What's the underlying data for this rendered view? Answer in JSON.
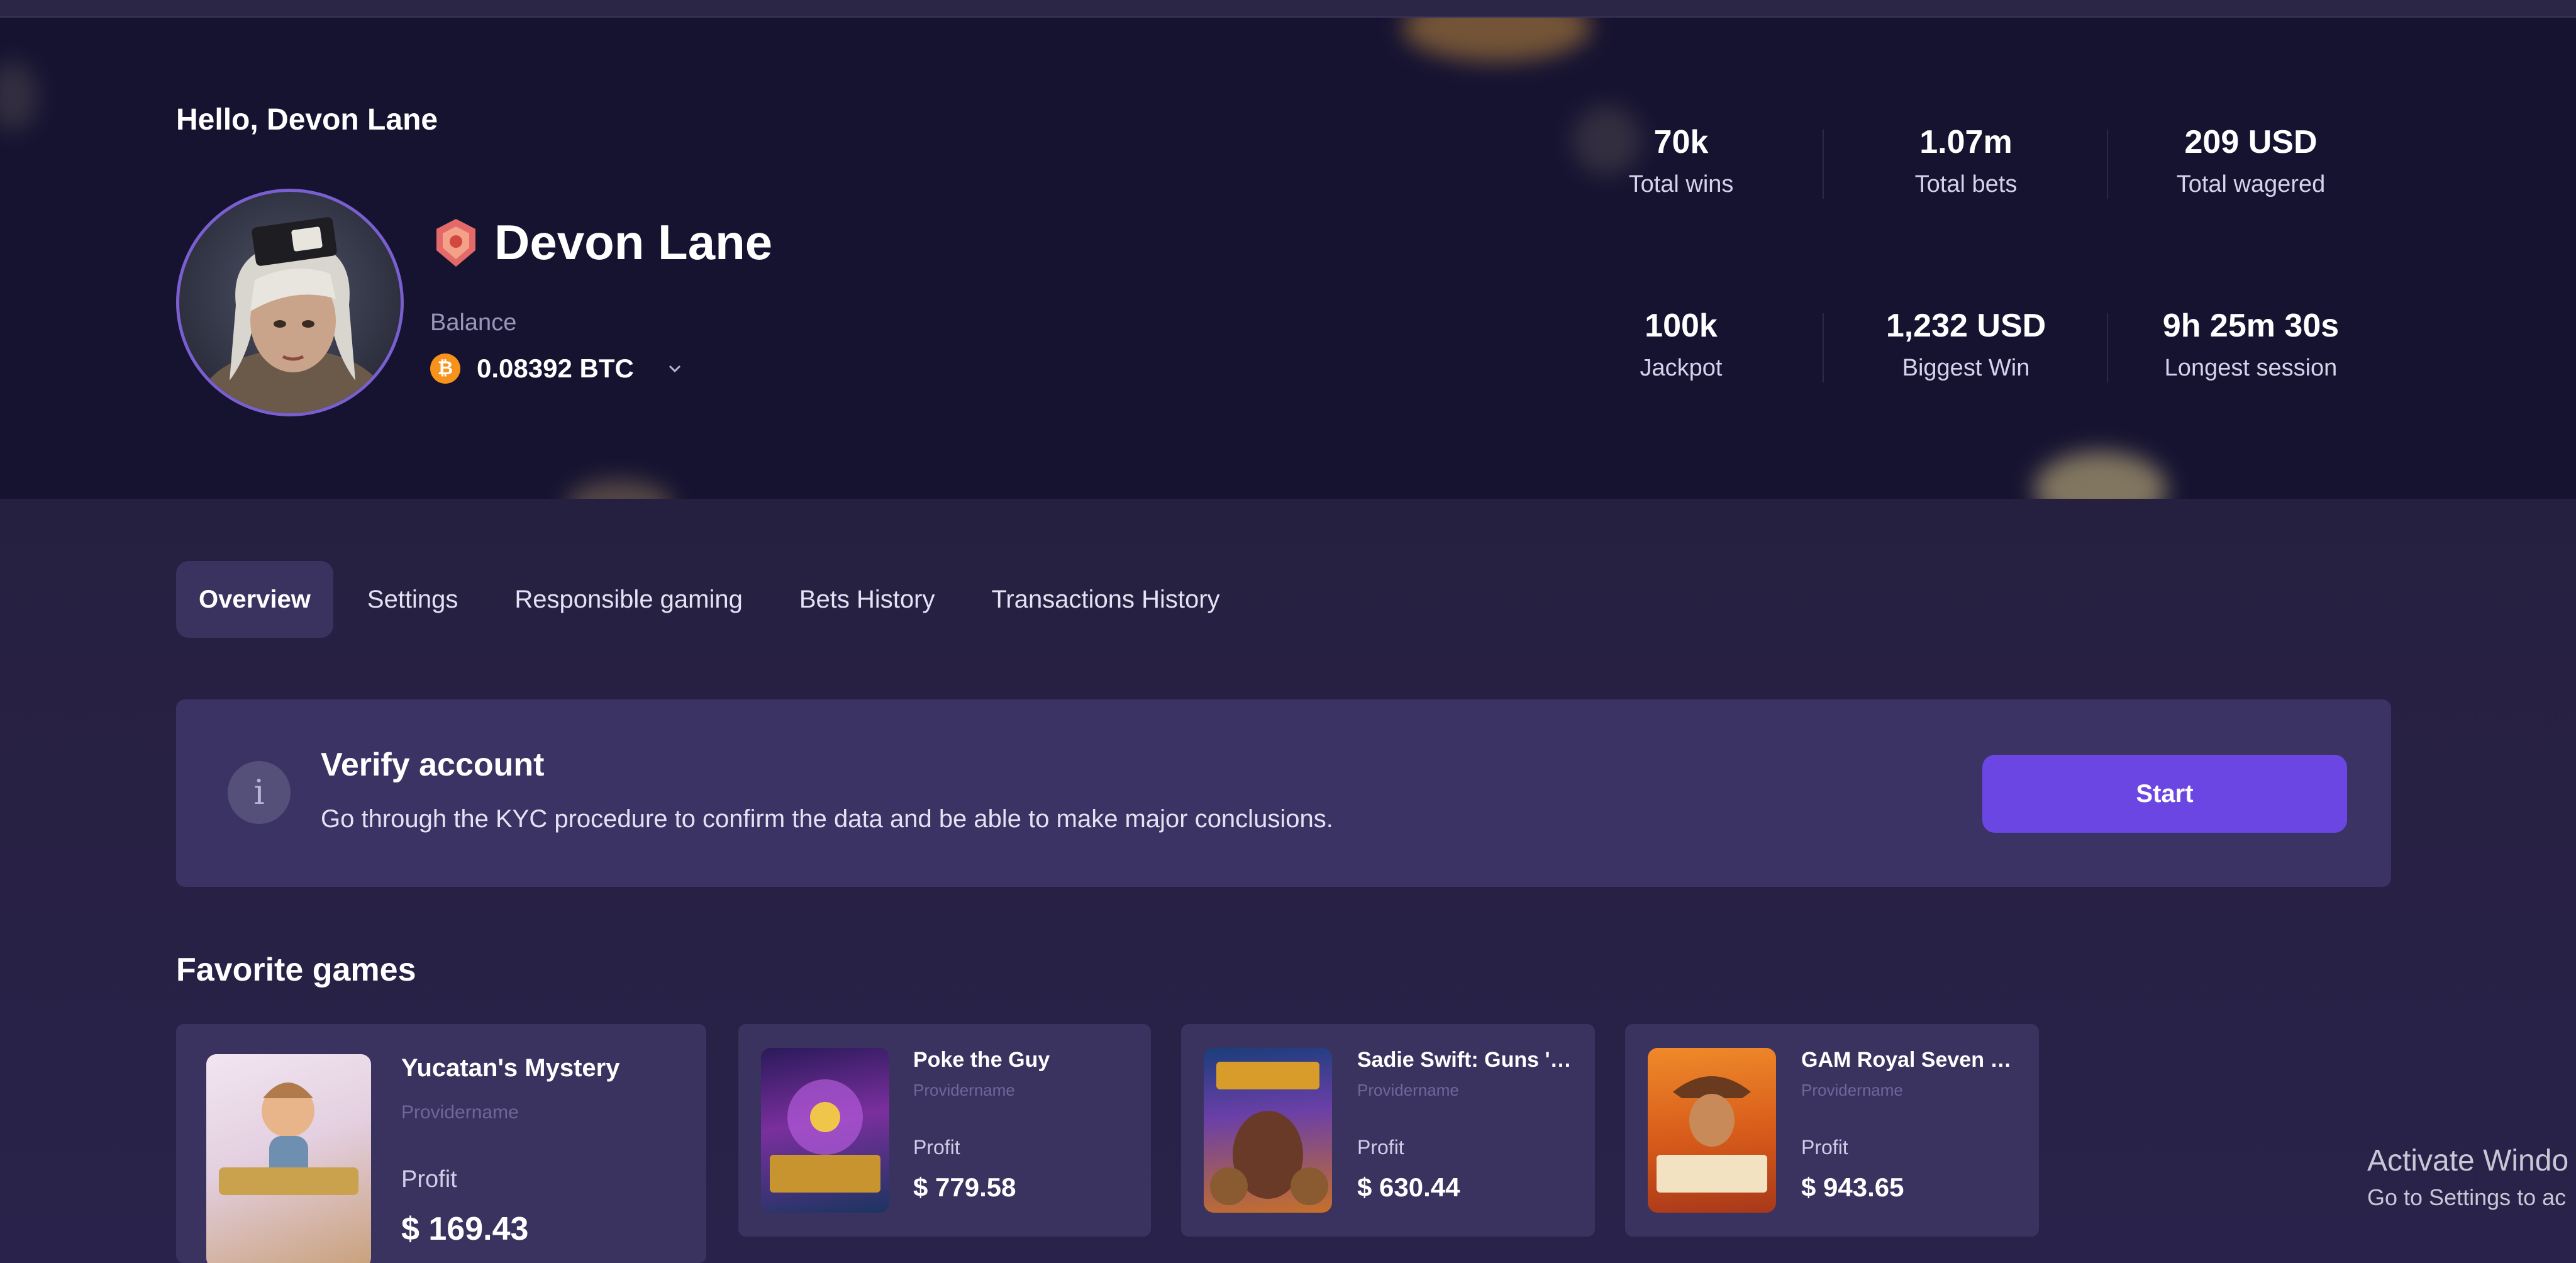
{
  "header": {
    "greeting": "Hello, Devon Lane",
    "user_name": "Devon Lane",
    "balance_label": "Balance",
    "balance_value": "0.08392 BTC",
    "currency_symbol": "₿"
  },
  "stats": [
    {
      "value": "70k",
      "label": "Total wins"
    },
    {
      "value": "1.07m",
      "label": "Total bets"
    },
    {
      "value": "209 USD",
      "label": "Total wagered"
    },
    {
      "value": "100k",
      "label": "Jackpot"
    },
    {
      "value": "1,232 USD",
      "label": "Biggest Win"
    },
    {
      "value": "9h 25m 30s",
      "label": "Longest session"
    }
  ],
  "tabs": [
    {
      "label": "Overview",
      "active": true
    },
    {
      "label": "Settings",
      "active": false
    },
    {
      "label": "Responsible gaming",
      "active": false
    },
    {
      "label": "Bets History",
      "active": false
    },
    {
      "label": "Transactions History",
      "active": false
    }
  ],
  "verify": {
    "icon": "i",
    "title": "Verify account",
    "description": "Go through the KYC procedure to confirm the data and be able to make major conclusions.",
    "button_label": "Start"
  },
  "favorites": {
    "title": "Favorite games",
    "games": [
      {
        "name": "Yucatan's Mystery",
        "provider": "Providername",
        "profit_label": "Profit",
        "profit": "$ 169.43"
      },
      {
        "name": "Poke the Guy",
        "provider": "Providername",
        "profit_label": "Profit",
        "profit": "$ 779.58"
      },
      {
        "name": "Sadie Swift: Guns 'n...",
        "provider": "Providername",
        "profit_label": "Profit",
        "profit": "$ 630.44"
      },
      {
        "name": "GAM Royal Seven XXL",
        "provider": "Providername",
        "profit_label": "Profit",
        "profit": "$ 943.65"
      }
    ]
  },
  "watermark": {
    "line1": "Activate Windo",
    "line2": "Go to Settings to ac"
  },
  "colors": {
    "accent": "#6b46e2",
    "hero_bg": "#161331",
    "page_bg": "#26203f",
    "card_bg": "#3a325f",
    "bitcoin": "#f7931a"
  }
}
